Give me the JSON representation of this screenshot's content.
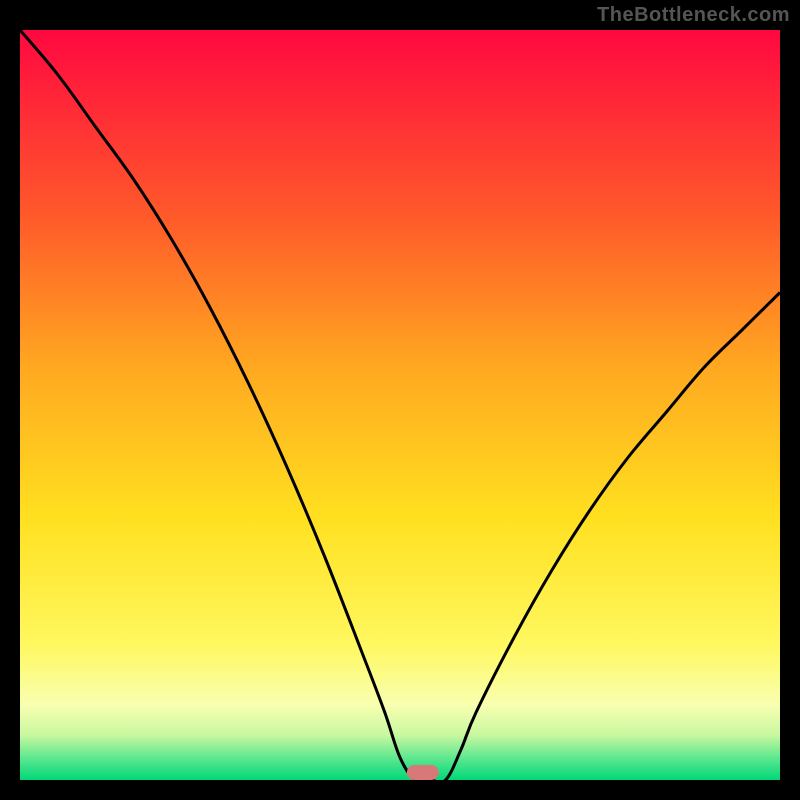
{
  "watermark": "TheBottleneck.com",
  "chart_data": {
    "type": "line",
    "title": "",
    "xlabel": "",
    "ylabel": "",
    "xlim": [
      0,
      100
    ],
    "ylim": [
      0,
      100
    ],
    "x": [
      0,
      5,
      10,
      15,
      20,
      25,
      30,
      35,
      40,
      45,
      48,
      50,
      52,
      54,
      56,
      58,
      60,
      65,
      70,
      75,
      80,
      85,
      90,
      95,
      100
    ],
    "values": [
      100,
      94,
      87,
      80,
      72,
      63,
      53,
      42,
      30,
      17,
      9,
      3,
      0,
      0,
      0,
      4,
      9,
      19,
      28,
      36,
      43,
      49,
      55,
      60,
      65
    ],
    "gradient_stops": [
      {
        "pos": 0.0,
        "color": "#ff0840"
      },
      {
        "pos": 0.25,
        "color": "#ff5a2a"
      },
      {
        "pos": 0.45,
        "color": "#ffa820"
      },
      {
        "pos": 0.65,
        "color": "#ffe020"
      },
      {
        "pos": 0.82,
        "color": "#fff860"
      },
      {
        "pos": 0.9,
        "color": "#f8ffb0"
      },
      {
        "pos": 0.94,
        "color": "#c8f8a0"
      },
      {
        "pos": 0.97,
        "color": "#60e890"
      },
      {
        "pos": 1.0,
        "color": "#00d878"
      }
    ],
    "marker": {
      "x": 53,
      "y": 1,
      "w": 4.2,
      "h": 2.0,
      "color": "#d87878"
    },
    "colors": {
      "frame": "#000000",
      "line": "#000000"
    }
  }
}
